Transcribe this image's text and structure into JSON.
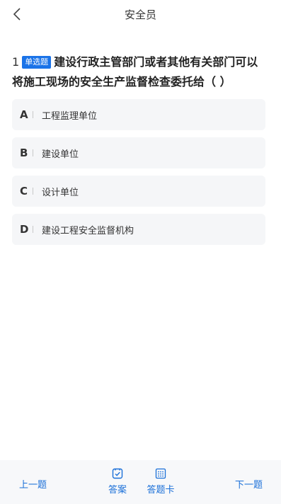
{
  "header": {
    "title": "安全员",
    "back_icon": "chevron-left-icon"
  },
  "question": {
    "number": "1",
    "type": "单选题",
    "text": "建设行政主管部门或者其他有关部门可以将施工现场的安全生产监督检查委托给（    ）"
  },
  "options": [
    {
      "letter": "A",
      "text": "工程监理单位"
    },
    {
      "letter": "B",
      "text": "建设单位"
    },
    {
      "letter": "C",
      "text": "设计单位"
    },
    {
      "letter": "D",
      "text": "建设工程安全监督机构"
    }
  ],
  "bottom_bar": {
    "prev_label": "上一题",
    "answer_label": "答案",
    "answer_icon": "answer-check-icon",
    "card_label": "答题卡",
    "card_icon": "answer-card-grid-icon",
    "next_label": "下一题"
  },
  "colors": {
    "accent": "#1a73e8",
    "option_bg": "#f5f6f8",
    "bottom_bar_bg": "#f7f8fa"
  }
}
